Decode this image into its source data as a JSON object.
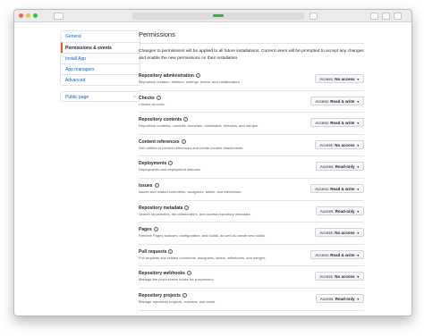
{
  "sidebar": {
    "items": [
      {
        "label": "General",
        "active": false
      },
      {
        "label": "Permissions & events",
        "active": true
      },
      {
        "label": "Install App",
        "active": false
      },
      {
        "label": "App managers",
        "active": false
      },
      {
        "label": "Advanced",
        "active": false
      }
    ],
    "public_page": "Public page"
  },
  "main": {
    "heading": "Permissions",
    "intro": "Changes to permissions will be applied to all future installations. Current users will be prompted to accept any changes and enable the new permissions on their installation.",
    "access_prefix": "Access:",
    "permissions": [
      {
        "title": "Repository administration",
        "desc": "Repository creation, deletion, settings, teams, and collaborators.",
        "access": "No access"
      },
      {
        "title": "Checks",
        "desc": "Checks on code.",
        "access": "Read & write"
      },
      {
        "title": "Repository contents",
        "desc": "Repository contents, commits, branches, downloads, releases, and merges.",
        "access": "Read & write"
      },
      {
        "title": "Content references",
        "desc": "Get notified of content references and create content attachments.",
        "access": "No access"
      },
      {
        "title": "Deployments",
        "desc": "Deployments and deployment statuses.",
        "access": "Read-only"
      },
      {
        "title": "Issues",
        "desc": "Issues and related comments, assignees, labels, and milestones.",
        "access": "Read & write"
      },
      {
        "title": "Repository metadata",
        "desc": "Search repositories, list collaborators, and access repository metadata.",
        "access": "Read-only"
      },
      {
        "title": "Pages",
        "desc": "Retrieve Pages statuses, configuration, and builds, as well as create new builds.",
        "access": "No access"
      },
      {
        "title": "Pull requests",
        "desc": "Pull requests and related comments, assignees, labels, milestones, and merges.",
        "access": "Read & write"
      },
      {
        "title": "Repository webhooks",
        "desc": "Manage the post-receive hooks for a repository.",
        "access": "No access"
      },
      {
        "title": "Repository projects",
        "desc": "Manage repository projects, columns, and cards.",
        "access": "Read-only"
      }
    ]
  }
}
